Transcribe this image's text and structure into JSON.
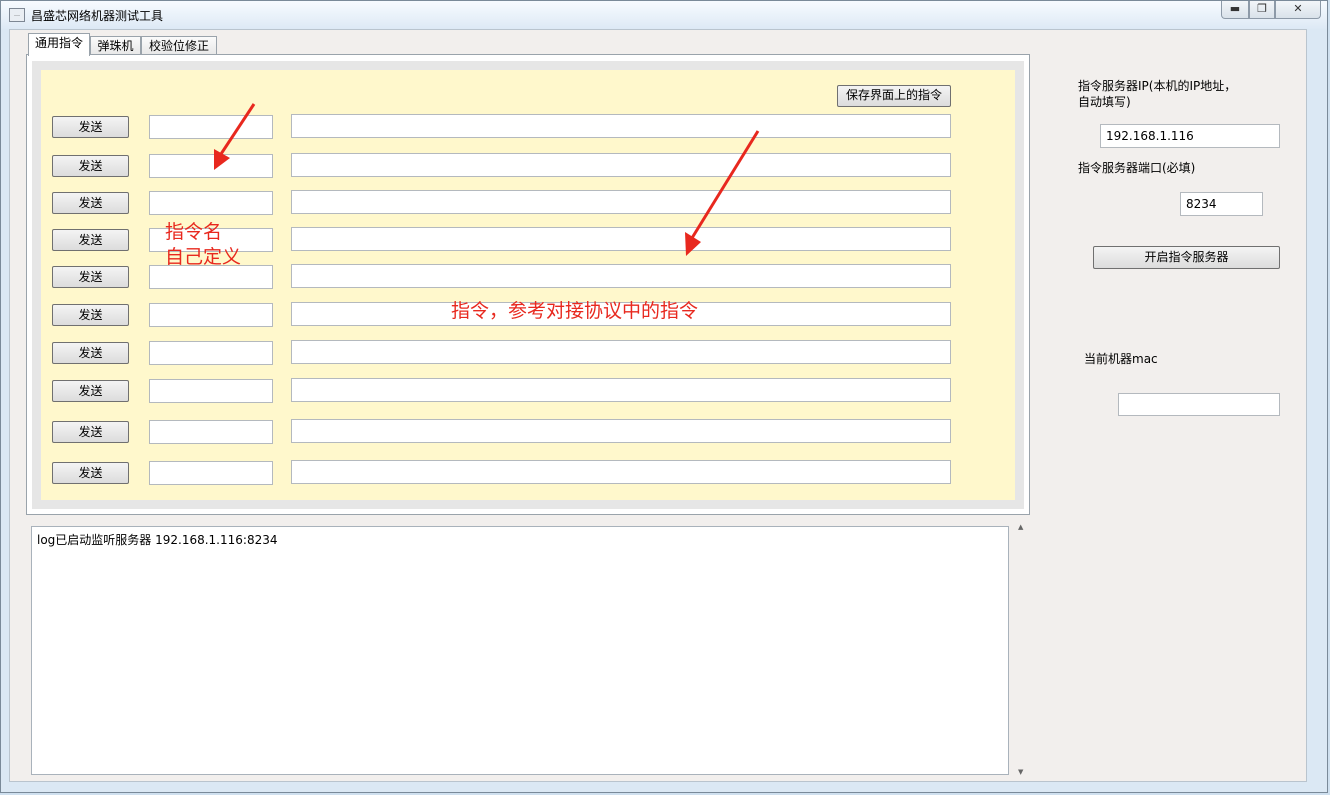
{
  "window": {
    "title": "昌盛芯网络机器测试工具",
    "app_icon_text": "…",
    "min_glyph": "▬",
    "max_glyph": "❐",
    "close_glyph": "✕"
  },
  "tabs": [
    {
      "label": "通用指令",
      "active": true
    },
    {
      "label": "弹珠机",
      "active": false
    },
    {
      "label": "校验位修正",
      "active": false
    }
  ],
  "commands": {
    "save_button_label": "保存界面上的指令",
    "send_label": "发送",
    "rows": [
      {
        "name": "",
        "command": ""
      },
      {
        "name": "",
        "command": ""
      },
      {
        "name": "",
        "command": ""
      },
      {
        "name": "",
        "command": ""
      },
      {
        "name": "",
        "command": ""
      },
      {
        "name": "",
        "command": ""
      },
      {
        "name": "",
        "command": ""
      },
      {
        "name": "",
        "command": ""
      },
      {
        "name": "",
        "command": ""
      },
      {
        "name": "",
        "command": ""
      }
    ]
  },
  "annotations": {
    "name_line1": "指令名",
    "name_line2": "自己定义",
    "command_hint": "指令，参考对接协议中的指令",
    "color": "#e8281e"
  },
  "server": {
    "ip_label_line1": "指令服务器IP(本机的IP地址，",
    "ip_label_line2": "自动填写)",
    "ip_value": "192.168.1.116",
    "port_label": "指令服务器端口(必填)",
    "port_value": "8234",
    "start_button_label": "开启指令服务器",
    "mac_label": "当前机器mac",
    "mac_value": ""
  },
  "log": {
    "text": "log已启动监听服务器 192.168.1.116:8234",
    "scroll_up_glyph": "▲",
    "scroll_down_glyph": "▼"
  }
}
